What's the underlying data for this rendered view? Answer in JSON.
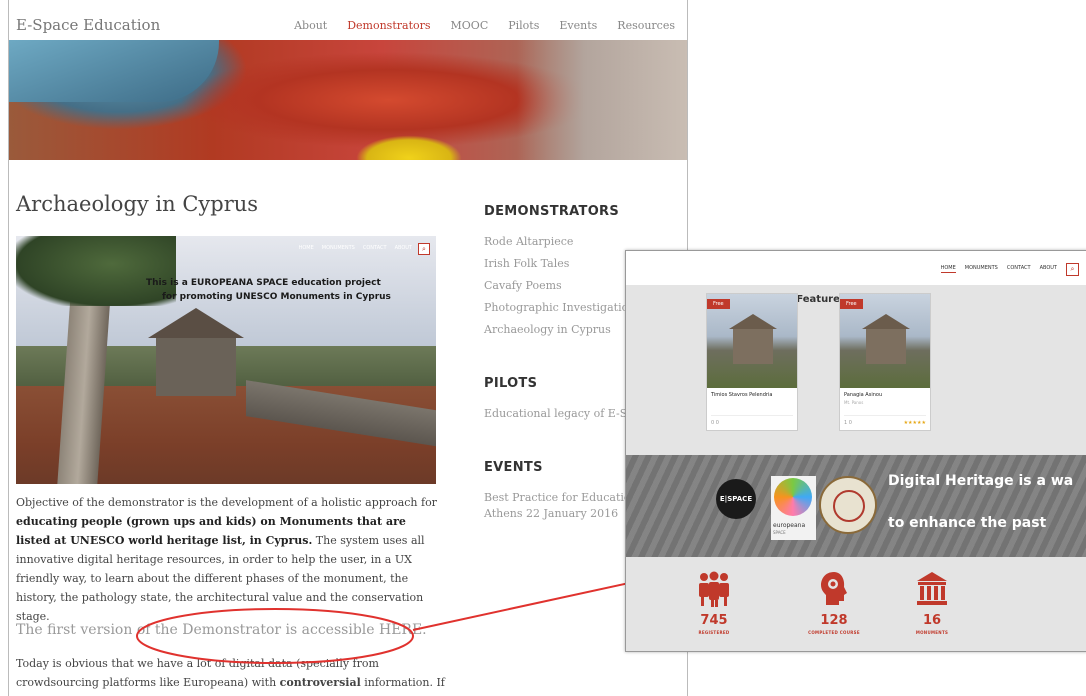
{
  "site": {
    "brand": "E-Space Education",
    "nav": [
      "About",
      "Demonstrators",
      "MOOC",
      "Pilots",
      "Events",
      "Resources"
    ],
    "active_nav": "Demonstrators"
  },
  "article": {
    "title": "Archaeology in Cyprus",
    "photo_overlay": {
      "line1": "This is a EUROPEANA SPACE education project",
      "line2": "for promoting UNESCO Monuments in Cyprus",
      "mini_nav": [
        "HOME",
        "MONUMENTS",
        "CONTACT",
        "ABOUT"
      ]
    },
    "paragraph1_a": "Objective of the demonstrator is the development of a holistic approach for ",
    "paragraph1_b": "educating people (grown ups and kids) on Monuments that are listed at UNESCO world heritage list, in Cyprus.",
    "paragraph1_c": " The system uses all innovative digital heritage resources, in order to help the user, in a UX friendly way, to learn about the different phases of the monument, the history, the pathology state, the architectural value and the conservation stage.",
    "access_link": "The first version of the Demonstrator is accessible HERE.",
    "paragraph2_a": "Today is obvious that we have a lot of digital data (specially from crowdsourcing platforms like Europeana) with ",
    "paragraph2_b": "controversial",
    "paragraph2_c": " information. If any student,"
  },
  "sidebar": {
    "demonstrators_heading": "DEMONSTRATORS",
    "demonstrators": [
      "Rode Altarpiece",
      "Irish Folk Tales",
      "Cavafy Poems",
      "Photographic Investigation of A",
      "Archaeology in Cyprus"
    ],
    "pilots_heading": "PILOTS",
    "pilots": [
      "Educational legacy of E-Space P"
    ],
    "events_heading": "EVENTS",
    "events": [
      "Best Practice for Education wor",
      "Athens 22 January 2016"
    ]
  },
  "overlay": {
    "nav": [
      "HOME",
      "MONUMENTS",
      "CONTACT",
      "ABOUT"
    ],
    "featured_heading": "Featured Monuments",
    "cards": [
      {
        "badge": "Free",
        "name": "Timios Stavros Pelendria",
        "meta": "0  0"
      },
      {
        "badge": "Free",
        "name": "Panagia Asinou",
        "sub": "Mt. Panos",
        "meta": "1  0",
        "stars": "★★★★★"
      }
    ],
    "banner_line1": "Digital Heritage is a wa",
    "banner_line2": "to enhance the past",
    "logo_espace": "E|SPACE",
    "logo_europeana": "europeana",
    "logo_europeana_sub": "SPACE",
    "stats": [
      {
        "value": "745",
        "label": "REGISTERED"
      },
      {
        "value": "128",
        "label": "COMPLETED COURSE"
      },
      {
        "value": "16",
        "label": "MONUMENTS"
      }
    ]
  },
  "colors": {
    "accent": "#c0392b",
    "annotation": "#e0322e"
  }
}
